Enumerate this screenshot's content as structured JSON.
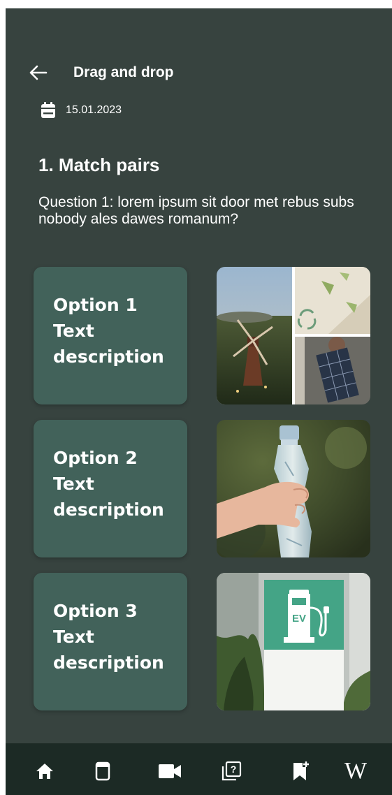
{
  "header": {
    "title": "Drag and drop",
    "back_icon": "arrow-left-icon"
  },
  "date": {
    "icon": "calendar-icon",
    "value": "15.01.2023"
  },
  "section": {
    "title": "1. Match pairs",
    "question": "Question 1: lorem ipsum sit door met rebus subs nobody ales dawes romanum?"
  },
  "options": [
    {
      "line1": "Option 1",
      "line2": "Text",
      "line3": "description"
    },
    {
      "line1": "Option 2",
      "line2": "Text",
      "line3": "description"
    },
    {
      "line1": "Option 3",
      "line2": "Text",
      "line3": "description"
    }
  ],
  "images": [
    {
      "subject": "renewable-energy-collage"
    },
    {
      "subject": "plastic-bottle-hand"
    },
    {
      "subject": "ev-charging-sign",
      "sign_text": "EV"
    }
  ],
  "bottom_nav": {
    "items": [
      {
        "icon": "home-icon",
        "active": true
      },
      {
        "icon": "book-icon"
      },
      {
        "icon": "video-camera-icon"
      },
      {
        "icon": "quiz-icon",
        "glyph": "?"
      },
      {
        "icon": "bookmark-add-icon"
      },
      {
        "icon": "wikipedia-icon",
        "glyph": "W"
      }
    ]
  },
  "colors": {
    "background": "#37433f",
    "card": "#42625a",
    "nav_bar": "#1c2a25",
    "text": "#ffffff"
  }
}
